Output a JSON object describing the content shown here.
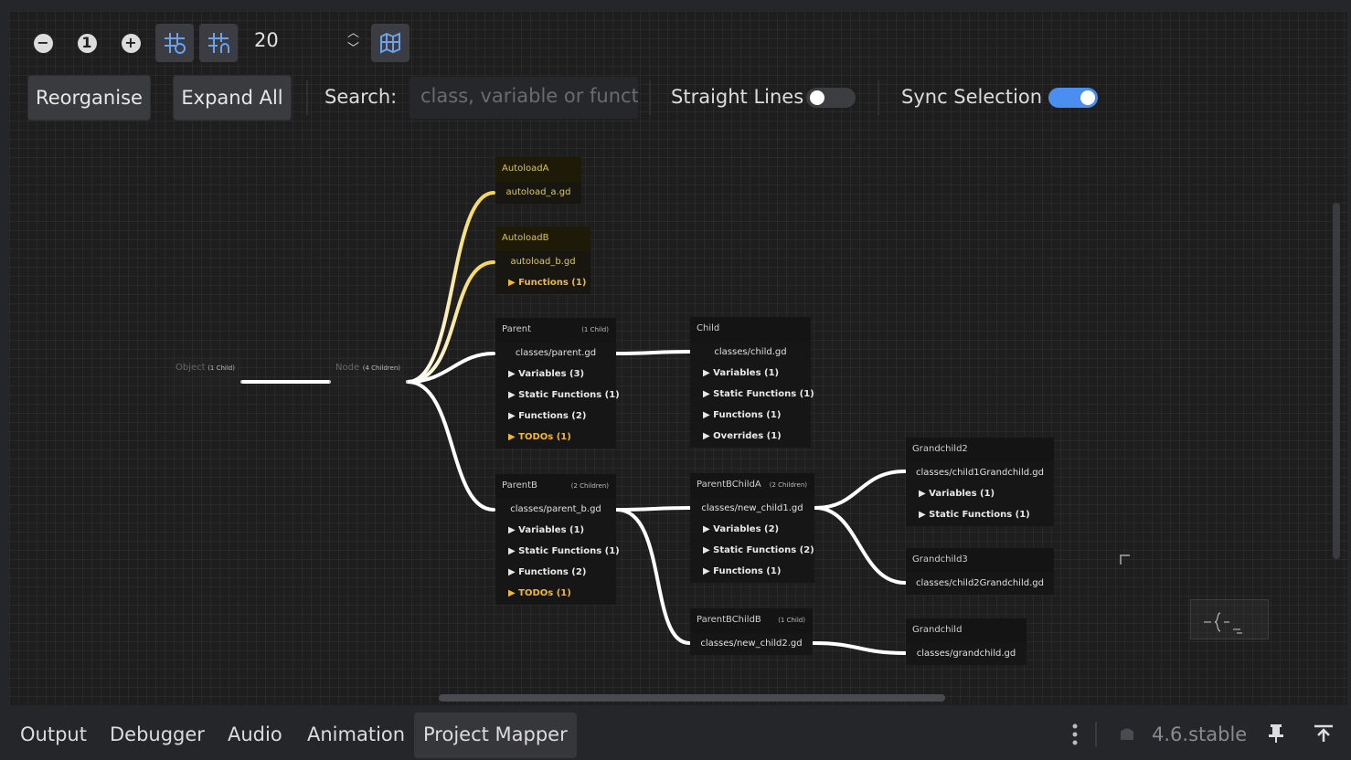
{
  "toolbar": {
    "zoom_out_icon": "minus-circle-icon",
    "zoom_reset_label": "1",
    "zoom_in_icon": "plus-circle-icon",
    "snap_value": "20",
    "reorganise_label": "Reorganise",
    "expand_all_label": "Expand All",
    "search_label": "Search:",
    "search_placeholder": "class, variable or funct",
    "straight_lines_label": "Straight Lines",
    "straight_lines_on": false,
    "sync_selection_label": "Sync Selection",
    "sync_selection_on": true,
    "accent_color": "#4a8ff0"
  },
  "nodes": {
    "object": {
      "title": "Object",
      "count": "(1 Child)"
    },
    "node": {
      "title": "Node",
      "count": "(4 Children)"
    },
    "autoloadA": {
      "title": "AutoloadA",
      "file": "autoload_a.gd"
    },
    "autoloadB": {
      "title": "AutoloadB",
      "file": "autoload_b.gd",
      "rows": [
        "▶ Functions (1)"
      ]
    },
    "parent": {
      "title": "Parent",
      "count": "(1 Child)",
      "file": "classes/parent.gd",
      "rows": [
        "▶ Variables (3)",
        "▶ Static Functions (1)",
        "▶ Functions (2)"
      ],
      "todo": "▶ TODOs (1)"
    },
    "child": {
      "title": "Child",
      "file": "classes/child.gd",
      "rows": [
        "▶ Variables (1)",
        "▶ Static Functions (1)",
        "▶ Functions (1)",
        "▶ Overrides (1)"
      ]
    },
    "parentB": {
      "title": "ParentB",
      "count": "(2 Children)",
      "file": "classes/parent_b.gd",
      "rows": [
        "▶ Variables (1)",
        "▶ Static Functions (1)",
        "▶ Functions (2)"
      ],
      "todo": "▶ TODOs (1)"
    },
    "parentBChildA": {
      "title": "ParentBChildA",
      "count": "(2 Children)",
      "file": "classes/new_child1.gd",
      "rows": [
        "▶ Variables (2)",
        "▶ Static Functions (2)",
        "▶ Functions (1)"
      ]
    },
    "parentBChildB": {
      "title": "ParentBChildB",
      "count": "(1 Child)",
      "file": "classes/new_child2.gd"
    },
    "grandchild2": {
      "title": "Grandchild2",
      "file": "classes/child1Grandchild.gd",
      "rows": [
        "▶ Variables (1)",
        "▶ Static Functions (1)"
      ]
    },
    "grandchild3": {
      "title": "Grandchild3",
      "file": "classes/child2Grandchild.gd"
    },
    "grandchild": {
      "title": "Grandchild",
      "file": "classes/grandchild.gd"
    }
  },
  "bottom_tabs": [
    "Output",
    "Debugger",
    "Audio",
    "Animation",
    "Project Mapper"
  ],
  "selected_tab": "Project Mapper",
  "version": "4.6.stable",
  "colors": {
    "wire": "#ffffff",
    "autoload_wire": "#f5d451",
    "todo": "#f0b83a"
  }
}
